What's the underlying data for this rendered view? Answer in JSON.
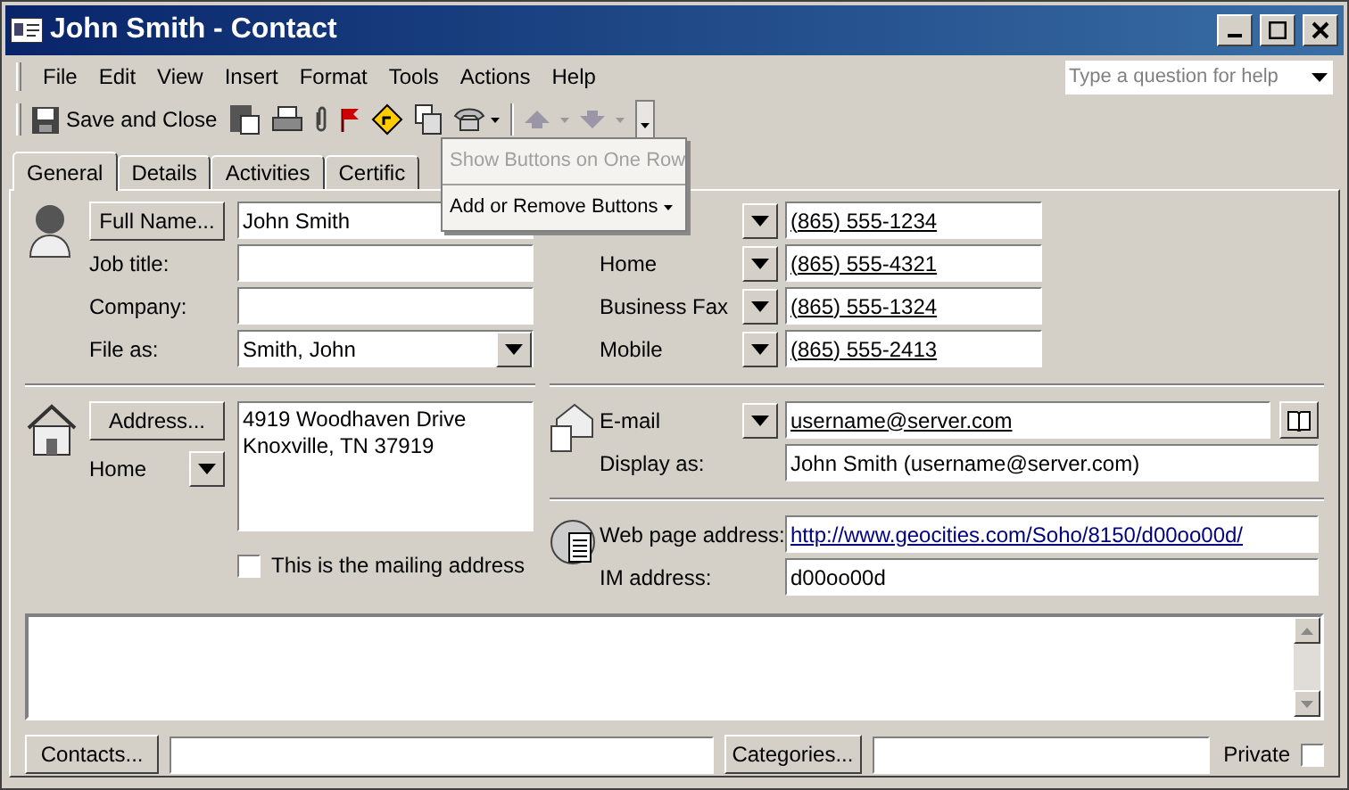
{
  "window": {
    "title": "John Smith - Contact"
  },
  "menu": [
    {
      "label": "File"
    },
    {
      "label": "Edit"
    },
    {
      "label": "View"
    },
    {
      "label": "Insert"
    },
    {
      "label": "Format"
    },
    {
      "label": "Tools"
    },
    {
      "label": "Actions"
    },
    {
      "label": "Help"
    }
  ],
  "help_box": {
    "placeholder": "Type a question for help"
  },
  "toolbar": {
    "save_label": "Save and Close"
  },
  "toolbar_menu": [
    {
      "label": "Show Buttons on One Row",
      "disabled": true
    },
    {
      "label": "Add or Remove Buttons",
      "disabled": false
    }
  ],
  "tabs": [
    {
      "label": "General",
      "selected": true
    },
    {
      "label": "Details",
      "selected": false
    },
    {
      "label": "Activities",
      "selected": false
    },
    {
      "label": "Certific",
      "selected": false
    }
  ],
  "name_fields": [
    {
      "kind": "button",
      "label": "Full Name...",
      "value": "John Smith"
    },
    {
      "kind": "text",
      "label": "Job title:"
    },
    {
      "kind": "text",
      "label": "Company:"
    },
    {
      "kind": "combo",
      "label": "File as:",
      "value": "Smith, John"
    }
  ],
  "address": {
    "button": "Address...",
    "type": "Home",
    "lines": [
      "4919 Woodhaven Drive",
      "Knoxville, TN  37919"
    ],
    "mailing": {
      "label": "This is the mailing address",
      "checked": false
    }
  },
  "phones": [
    {
      "value": "(865) 555-1234"
    },
    {
      "label": "Home",
      "value": "(865) 555-4321"
    },
    {
      "label": "Business Fax",
      "value": "(865) 555-1324"
    },
    {
      "label": "Mobile",
      "value": "(865) 555-2413"
    }
  ],
  "email": {
    "label": "E-mail",
    "value": "username@server.com",
    "display_label": "Display as:",
    "display_value": "John Smith (username@server.com)"
  },
  "web": {
    "label": "Web page address:",
    "value": "http://www.geocities.com/Soho/8150/d00oo00d/"
  },
  "im": {
    "label": "IM address:",
    "value": "d00oo00d"
  },
  "bottom": {
    "contacts": "Contacts...",
    "categories": "Categories...",
    "private": {
      "label": "Private",
      "checked": false
    }
  }
}
